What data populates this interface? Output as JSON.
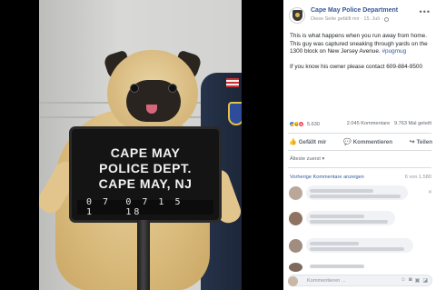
{
  "post": {
    "page_name": "Cape May Police Department",
    "page_meta_text": "Diese Seite gefällt mir · 15. Juli ·",
    "body_line1": "This is what happens when you run away from home. This guy was captured sneaking through yards on the 1300 block on New Jersey Avenue.",
    "hashtag": "#pugmug",
    "body_line2": "If you know his owner please contact 609-884-9500"
  },
  "photo": {
    "sign_line1": "CAPE MAY",
    "sign_line2": "POLICE DEPT.",
    "sign_line3": "CAPE MAY, NJ",
    "sign_num_left": "0 7 1",
    "sign_num_right": "0 7 1 5 18"
  },
  "stats": {
    "reaction_count": "5.630",
    "comments_text": "2.045 Kommentare",
    "shares_text": "9.763 Mal geteilt"
  },
  "actions": {
    "like_label": "Gefällt mir",
    "comment_label": "Kommentieren",
    "share_label": "Teilen"
  },
  "comments": {
    "sort_label": "Älteste zuerst ▾",
    "previous_label": "Vorherige Kommentare anzeigen",
    "previous_count": "6 von 1.580",
    "composer_placeholder": "Kommentieren ..."
  },
  "icons": {
    "more": "more-icon",
    "like": "like-icon",
    "comment": "comment-icon",
    "share": "share-icon",
    "globe": "globe-icon"
  },
  "colors": {
    "link_blue": "#365899",
    "like_blue": "#1877f2",
    "text_gray": "#606770",
    "bubble_gray": "#f0f2f5"
  }
}
